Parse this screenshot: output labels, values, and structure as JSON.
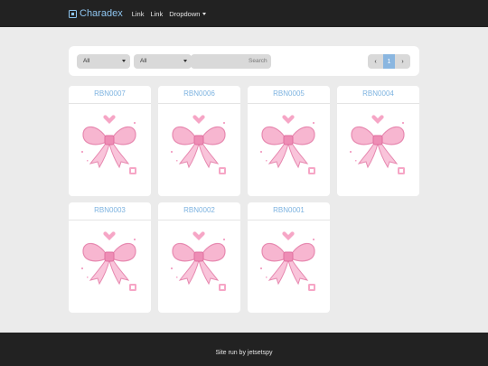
{
  "navbar": {
    "brand": "Charadex",
    "links": [
      "Link",
      "Link"
    ],
    "dropdown": "Dropdown"
  },
  "filters": {
    "select1": "All",
    "select2": "All",
    "search_placeholder": "Search"
  },
  "pager": {
    "prev": "‹",
    "current": "1",
    "next": "›"
  },
  "cards": [
    "RBN0007",
    "RBN0006",
    "RBN0005",
    "RBN0004",
    "RBN0003",
    "RBN0002",
    "RBN0001"
  ],
  "footer": {
    "text": "Site run by jetsetspy"
  },
  "colors": {
    "navbar": "#222222",
    "accent": "#8ec5f0",
    "card_title": "#7db3e0",
    "bow": "#f4a7c8"
  }
}
